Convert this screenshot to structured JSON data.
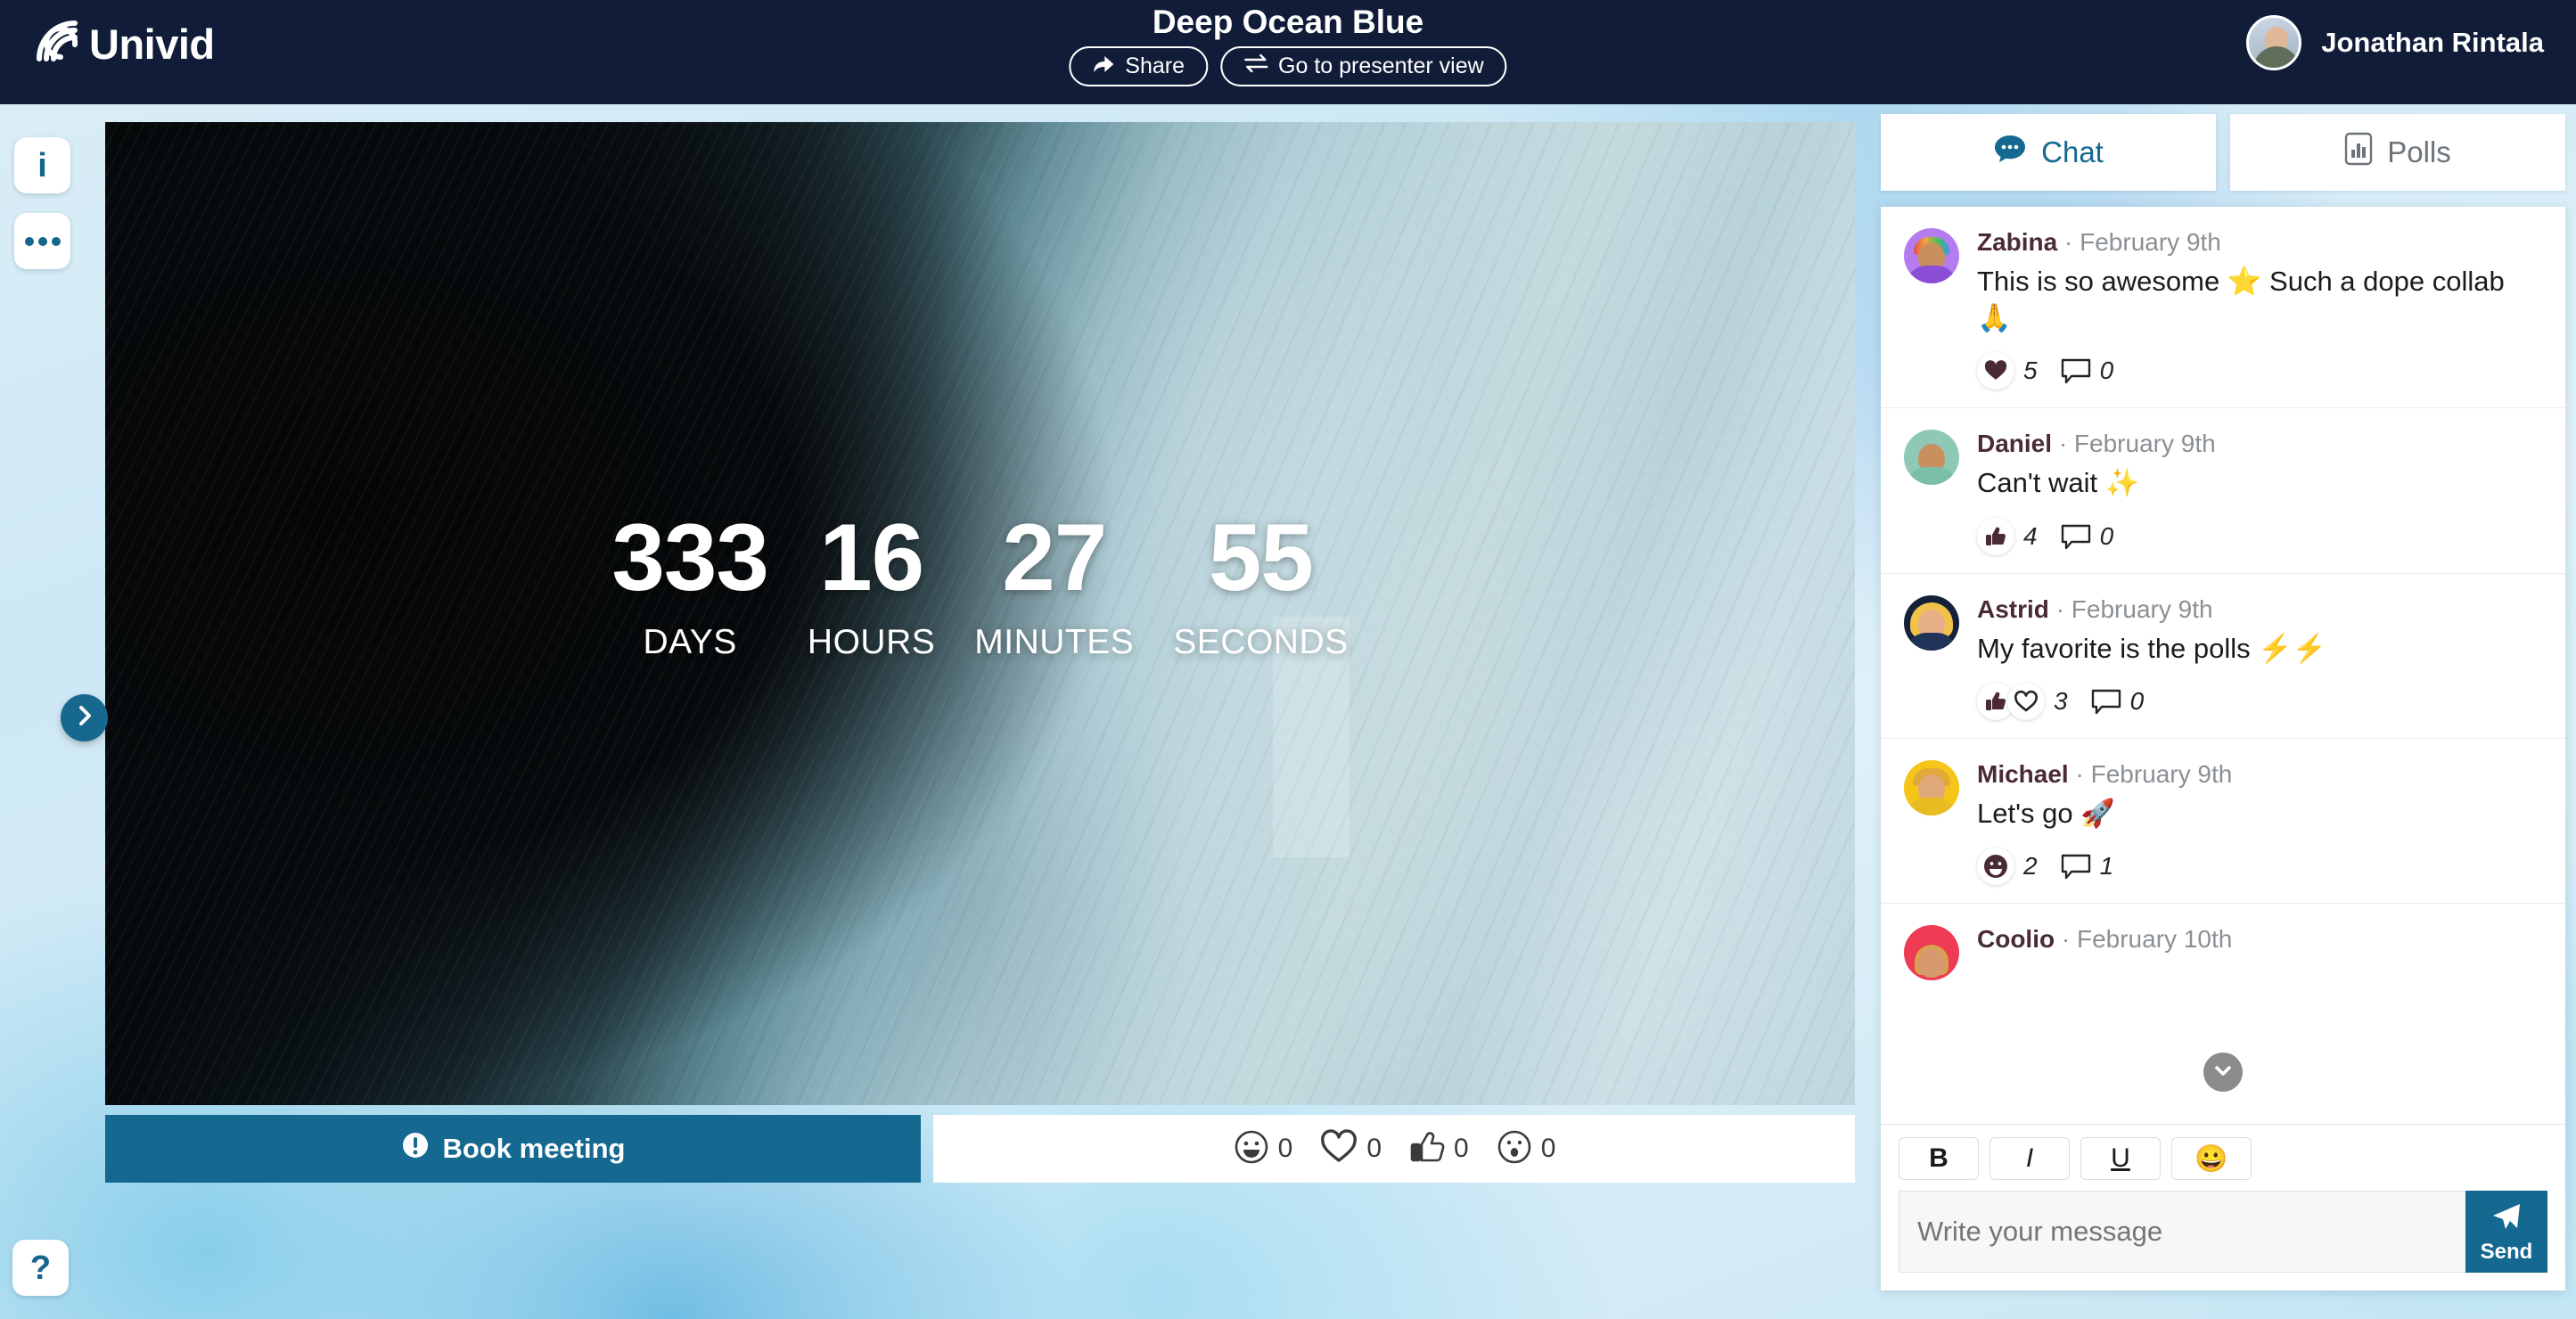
{
  "header": {
    "logo_text": "Univid",
    "logo_icon": "univid-arcs-logo-icon",
    "meeting_title": "Deep Ocean Blue",
    "share_label": "Share",
    "share_icon": "share-arrow-icon",
    "presenter_label": "Go to presenter view",
    "presenter_icon": "swap-arrows-icon",
    "user_name": "Jonathan Rintala",
    "avatar_icon": "user-avatar"
  },
  "left_rail": {
    "info_icon": "info-icon",
    "info_glyph": "i",
    "more_icon": "ellipsis-icon",
    "help_icon": "question-mark-icon",
    "help_glyph": "?",
    "collapse_icon": "chevron-right-icon"
  },
  "stage": {
    "countdown": [
      {
        "value": "333",
        "label": "DAYS"
      },
      {
        "value": "16",
        "label": "HOURS"
      },
      {
        "value": "27",
        "label": "MINUTES"
      },
      {
        "value": "55",
        "label": "SECONDS"
      }
    ]
  },
  "bottombar": {
    "book_label": "Book meeting",
    "book_icon": "exclamation-circle-icon",
    "reactions": [
      {
        "icon": "smiley-face-icon",
        "count": "0"
      },
      {
        "icon": "heart-outline-icon",
        "count": "0"
      },
      {
        "icon": "thumbs-up-icon",
        "count": "0"
      },
      {
        "icon": "surprised-face-icon",
        "count": "0"
      }
    ]
  },
  "right_panel": {
    "tabs": [
      {
        "label": "Chat",
        "icon": "chat-bubble-icon",
        "active": true
      },
      {
        "label": "Polls",
        "icon": "bar-chart-icon",
        "active": false
      }
    ],
    "messages": [
      {
        "author": "Zabina",
        "sep": "·",
        "date": "February 9th",
        "text": "This is so awesome ⭐ Such a dope collab 🙏",
        "reaction_icon": "heart-filled-icon",
        "reaction_count": "5",
        "comment_icon": "comment-icon",
        "comment_count": "0",
        "avatar": "avatar-zabina"
      },
      {
        "author": "Daniel",
        "sep": "·",
        "date": "February 9th",
        "text": "Can't wait ✨",
        "reaction_icon": "thumbs-up-icon",
        "reaction_count": "4",
        "comment_icon": "comment-icon",
        "comment_count": "0",
        "avatar": "avatar-daniel"
      },
      {
        "author": "Astrid",
        "sep": "·",
        "date": "February 9th",
        "text": "My favorite is the polls ⚡⚡",
        "reaction_icon": "thumbs-up-and-heart-icon",
        "reaction_count": "3",
        "comment_icon": "comment-icon",
        "comment_count": "0",
        "avatar": "avatar-astrid"
      },
      {
        "author": "Michael",
        "sep": "·",
        "date": "February 9th",
        "text": "Let's go 🚀",
        "reaction_icon": "smiley-filled-icon",
        "reaction_count": "2",
        "comment_icon": "comment-icon",
        "comment_count": "1",
        "avatar": "avatar-michael"
      },
      {
        "author": "Coolio",
        "sep": "·",
        "date": "February 10th",
        "text": "",
        "reaction_icon": "",
        "reaction_count": "",
        "comment_icon": "",
        "comment_count": "",
        "avatar": "avatar-coolio"
      }
    ],
    "scroll_down_icon": "chevron-down-icon",
    "composer": {
      "bold_label": "B",
      "italic_label": "I",
      "underline_label": "U",
      "emoji_label": "😀",
      "placeholder": "Write your message",
      "send_label": "Send",
      "send_icon": "paper-plane-icon"
    }
  },
  "colors": {
    "header_bg": "#101c38",
    "accent": "#15688f",
    "tab_active": "#15688f",
    "tab_inactive": "#6d7479",
    "panel_bg": "#ffffff"
  }
}
